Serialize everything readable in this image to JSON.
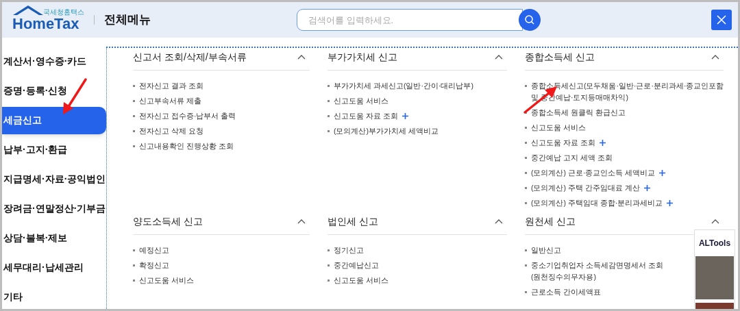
{
  "header": {
    "logo_caption": "국세청홈택스",
    "logo": "HomeTax",
    "title": "전체메뉴",
    "search": {
      "placeholder": "검색어를 입력하세요."
    }
  },
  "sidebar": {
    "items": [
      {
        "label": "계산서·영수증·카드",
        "selected": false
      },
      {
        "label": "증명·등록·신청",
        "selected": false
      },
      {
        "label": "세금신고",
        "selected": true
      },
      {
        "label": "납부·고지·환급",
        "selected": false
      },
      {
        "label": "지급명세·자료·공익법인",
        "selected": false
      },
      {
        "label": "장려금·연말정산·기부금",
        "selected": false
      },
      {
        "label": "상담·불복·제보",
        "selected": false
      },
      {
        "label": "세무대리·납세관리",
        "selected": false
      },
      {
        "label": "기타",
        "selected": false
      }
    ]
  },
  "sections": [
    {
      "title": "신고서 조회/삭제/부속서류",
      "expanded": true,
      "items": [
        {
          "label": "전자신고 결과 조회",
          "more": false
        },
        {
          "label": "신고부속서류 제출",
          "more": false
        },
        {
          "label": "전자신고 접수증·납부서 출력",
          "more": false
        },
        {
          "label": "전자신고 삭제 요청",
          "more": false
        },
        {
          "label": "신고내용확인 진행상황 조회",
          "more": false
        }
      ]
    },
    {
      "title": "부가가치세 신고",
      "expanded": true,
      "items": [
        {
          "label": "부가가치세 과세신고(일반·간이·대리납부)",
          "more": false
        },
        {
          "label": "신고도움 서비스",
          "more": false
        },
        {
          "label": "신고도움 자료 조회",
          "more": true
        },
        {
          "label": "(모의계산)부가가치세 세액비교",
          "more": false
        }
      ]
    },
    {
      "title": "종합소득세 신고",
      "expanded": true,
      "items": [
        {
          "label": "종합소득세신고(모두채움·일반·근로·분리과세·종교인포함\n및 중간예납·토지등매매차익)",
          "more": false
        },
        {
          "label": "종합소득세 원클릭 환급신고",
          "more": false
        },
        {
          "label": "신고도움 서비스",
          "more": false
        },
        {
          "label": "신고도움 자료 조회",
          "more": true
        },
        {
          "label": "중간예납 고지 세액 조회",
          "more": false
        },
        {
          "label": "(모의계산) 근로·종교인소득 세액비교",
          "more": true
        },
        {
          "label": "(모의계산) 주택 간주임대료 계산",
          "more": true
        },
        {
          "label": "(모의계산) 주택임대 종합·분리과세비교",
          "more": true
        }
      ]
    },
    {
      "title": "양도소득세 신고",
      "expanded": true,
      "items": [
        {
          "label": "예정신고",
          "more": false
        },
        {
          "label": "확정신고",
          "more": false
        },
        {
          "label": "신고도움 서비스",
          "more": false
        }
      ]
    },
    {
      "title": "법인세 신고",
      "expanded": true,
      "items": [
        {
          "label": "정기신고",
          "more": false
        },
        {
          "label": "중간예납신고",
          "more": false
        },
        {
          "label": "신고도움 서비스",
          "more": false
        }
      ]
    },
    {
      "title": "원천세 신고",
      "expanded": true,
      "items": [
        {
          "label": "일반신고",
          "more": false
        },
        {
          "label": "중소기업취업자 소득세감면명세서 조회\n(원천징수의무자용)",
          "more": false
        },
        {
          "label": "근로소득 간이세액표",
          "more": false
        }
      ]
    }
  ],
  "overlay": {
    "title": "ALTools"
  }
}
